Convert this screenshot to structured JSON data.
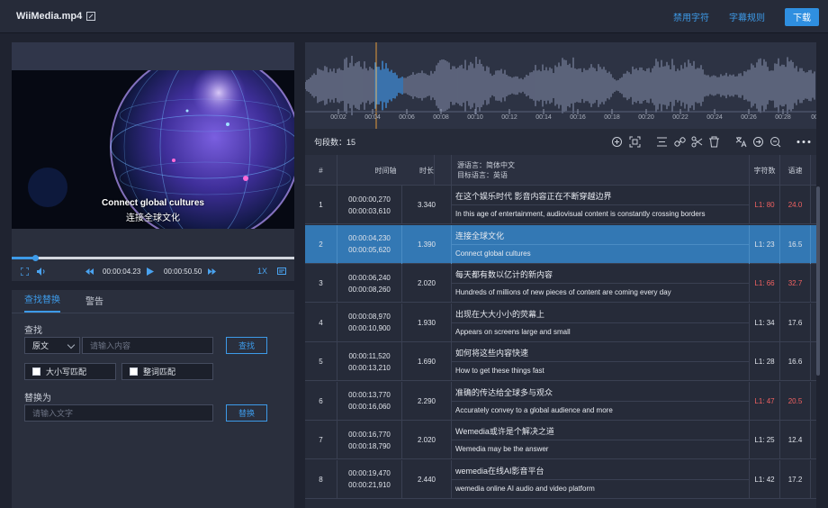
{
  "header": {
    "filename": "WiiMedia.mp4",
    "links": [
      "禁用字符",
      "字幕规则"
    ],
    "download_label": "下载"
  },
  "player": {
    "subtitle_en": "Connect global cultures",
    "subtitle_zh": "连接全球文化",
    "current_time": "00:00:04.23",
    "total_time": "00:00:50.50",
    "speed": "1X",
    "progress": 0.084
  },
  "search": {
    "tabs": [
      "查找替换",
      "警告"
    ],
    "find_label": "查找",
    "scope_value": "原文",
    "find_placeholder": "请输入内容",
    "find_button": "查找",
    "match_case": "大小写匹配",
    "whole_word": "整词匹配",
    "replace_label": "替换为",
    "replace_placeholder": "请输入文字",
    "replace_button": "替换"
  },
  "waveform": {
    "ticks": [
      "00:02",
      "00:04",
      "00:06",
      "00:08",
      "00:10",
      "00:12",
      "00:14",
      "00:16",
      "00:18",
      "00:20",
      "00:22",
      "00:24",
      "00:26",
      "00:28",
      "00:3"
    ]
  },
  "toolbar": {
    "segment_count": "句段数：15",
    "icons": [
      "add-segment-icon",
      "scan-icon",
      "align-icon",
      "link-icon",
      "scissors-icon",
      "trash-icon",
      "translate-icon",
      "arrow-right-icon",
      "search-zoom-icon",
      "more-icon"
    ]
  },
  "table": {
    "headers": {
      "index": "#",
      "timeline": "时间轴",
      "duration": "时长",
      "source_lang": "源语言：简体中文",
      "target_lang": "目标语言：英语",
      "char_count": "字符数",
      "speed": "语速"
    },
    "rows": [
      {
        "index": "1",
        "start": "00:00:00,270",
        "end": "00:00:03,610",
        "duration": "3.340",
        "zh": "在这个娱乐时代 影音内容正在不断穿越边界",
        "en": "In this age of entertainment, audiovisual content is constantly crossing borders",
        "chars": "L1: 80",
        "speed": "24.0",
        "warn": true
      },
      {
        "index": "2",
        "start": "00:00:04,230",
        "end": "00:00:05,620",
        "duration": "1.390",
        "zh": "连接全球文化",
        "en": "Connect global cultures",
        "chars": "L1: 23",
        "speed": "16.5",
        "warn": false,
        "selected": true
      },
      {
        "index": "3",
        "start": "00:00:06,240",
        "end": "00:00:08,260",
        "duration": "2.020",
        "zh": "每天都有数以亿计的新内容",
        "en": "Hundreds of millions of new pieces of content are coming every day",
        "chars": "L1: 66",
        "speed": "32.7",
        "warn": true
      },
      {
        "index": "4",
        "start": "00:00:08,970",
        "end": "00:00:10,900",
        "duration": "1.930",
        "zh": "出现在大大小小的荧幕上",
        "en": "Appears on screens large and small",
        "chars": "L1: 34",
        "speed": "17.6",
        "warn": false
      },
      {
        "index": "5",
        "start": "00:00:11,520",
        "end": "00:00:13,210",
        "duration": "1.690",
        "zh": "如何将这些内容快速",
        "en": "How to get these things fast",
        "chars": "L1: 28",
        "speed": "16.6",
        "warn": false
      },
      {
        "index": "6",
        "start": "00:00:13,770",
        "end": "00:00:16,060",
        "duration": "2.290",
        "zh": "准确的传达给全球多与观众",
        "en": "Accurately convey to a global audience and more",
        "chars": "L1: 47",
        "speed": "20.5",
        "warn": true
      },
      {
        "index": "7",
        "start": "00:00:16,770",
        "end": "00:00:18,790",
        "duration": "2.020",
        "zh": "Wemedia或许是个解决之道",
        "en": "Wemedia may be the answer",
        "chars": "L1: 25",
        "speed": "12.4",
        "warn": false
      },
      {
        "index": "8",
        "start": "00:00:19,470",
        "end": "00:00:21,910",
        "duration": "2.440",
        "zh": "wemedia在线AI影音平台",
        "en": "wemedia online AI audio and video platform",
        "chars": "L1: 42",
        "speed": "17.2",
        "warn": false
      }
    ]
  }
}
